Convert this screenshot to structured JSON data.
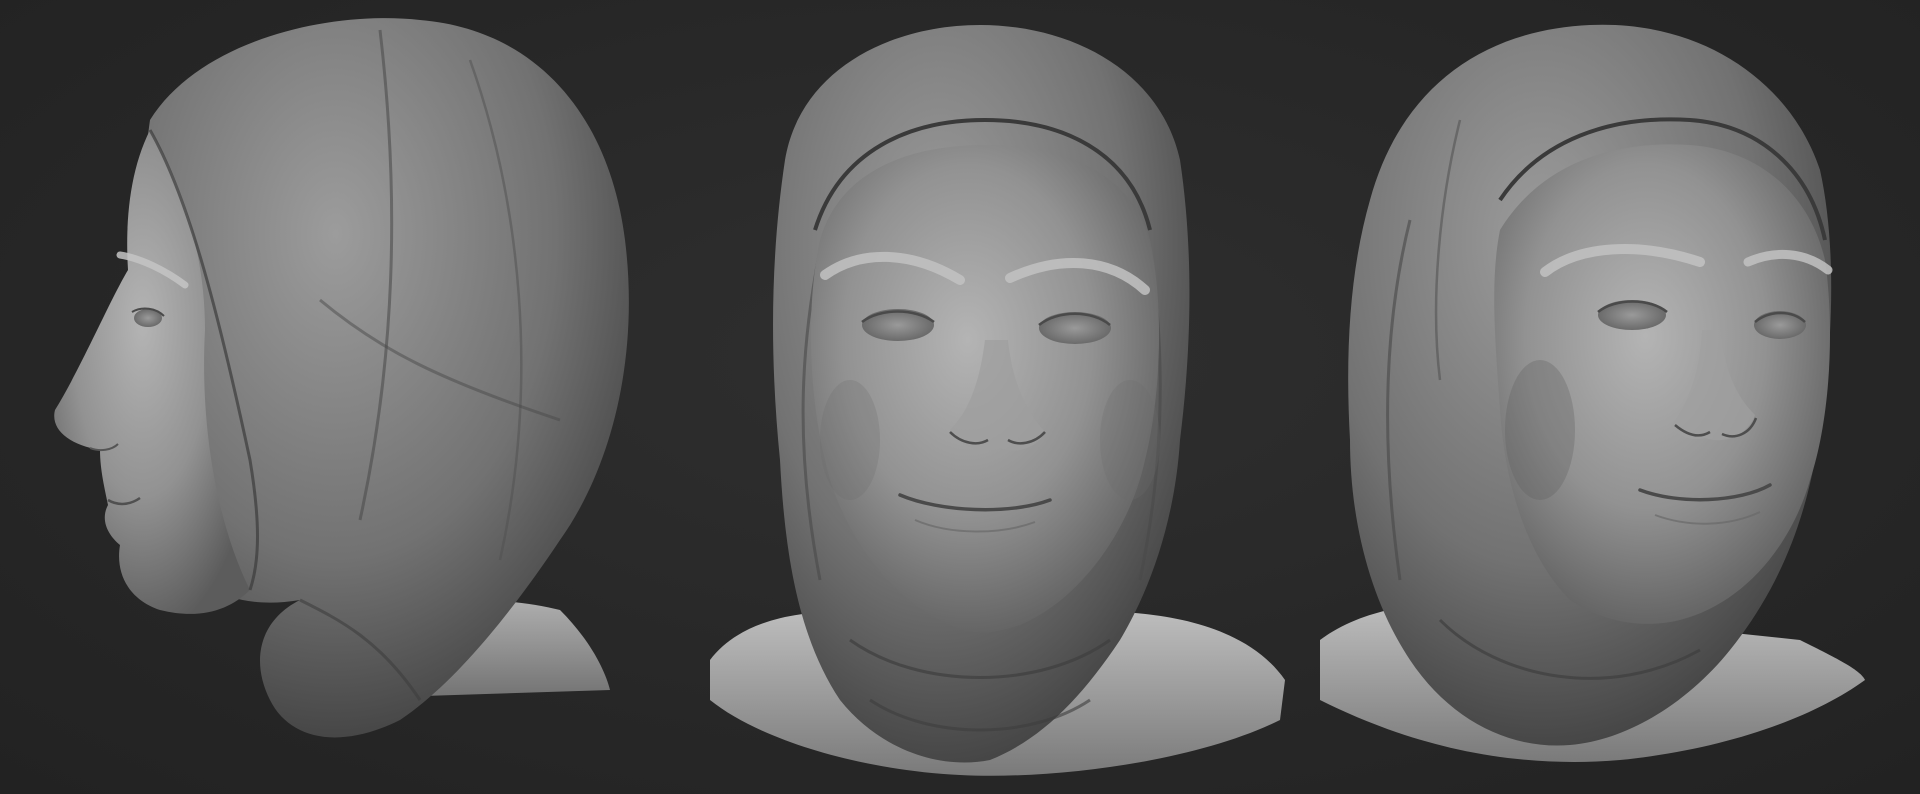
{
  "scene": {
    "views": [
      {
        "view": "profile-left"
      },
      {
        "view": "front"
      },
      {
        "view": "three-quarter"
      }
    ],
    "colors": {
      "background": "#272727",
      "clay_light": "#a6a6a6",
      "clay_mid": "#7d7d7d",
      "clay_dark": "#4a4a4a",
      "shadow": "#1e1e1e"
    }
  }
}
